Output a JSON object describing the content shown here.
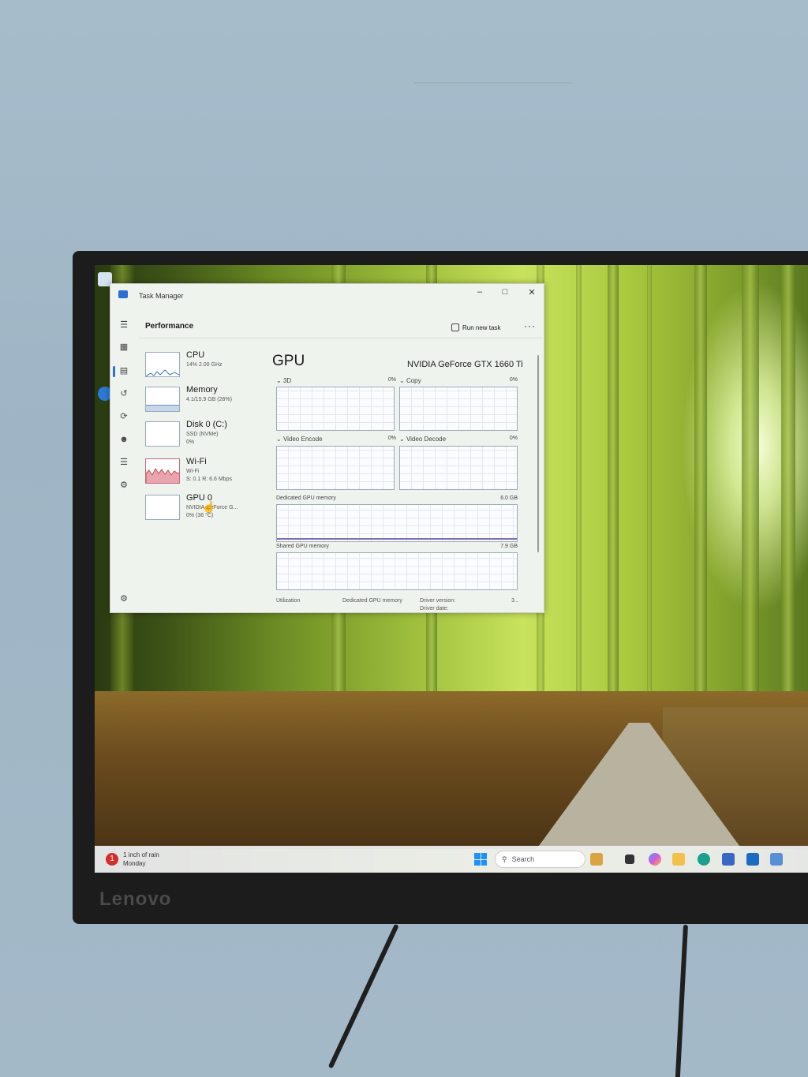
{
  "taskmanager": {
    "title": "Task Manager",
    "section": "Performance",
    "run_new_task": "Run new task",
    "more": "···",
    "items": [
      {
        "name": "CPU",
        "sub1": "14% 2.00 GHz",
        "sub2": "",
        "sub3": ""
      },
      {
        "name": "Memory",
        "sub1": "4.1/15.9 GB (26%)",
        "sub2": "",
        "sub3": ""
      },
      {
        "name": "Disk 0 (C:)",
        "sub1": "SSD (NVMe)",
        "sub2": "0%",
        "sub3": ""
      },
      {
        "name": "Wi-Fi",
        "sub1": "Wi-Fi",
        "sub2": "S: 0.1 R: 6.6 Mbps",
        "sub3": ""
      },
      {
        "name": "GPU 0",
        "sub1": "NVIDIA GeForce G...",
        "sub2": "0% (36 °C)",
        "sub3": ""
      }
    ],
    "gpu": {
      "title": "GPU",
      "model": "NVIDIA GeForce GTX 1660 Ti",
      "graphs": {
        "g3d": {
          "label": "3D",
          "value": "0%"
        },
        "copy": {
          "label": "Copy",
          "value": "0%"
        },
        "video_encode": {
          "label": "Video Encode",
          "value": "0%"
        },
        "video_decode": {
          "label": "Video Decode",
          "value": "0%"
        },
        "dedicated": {
          "label": "Dedicated GPU memory",
          "value": "6.0 GB"
        },
        "shared": {
          "label": "Shared GPU memory",
          "value": "7.9 GB"
        }
      },
      "stats": {
        "utilization": "Utilization",
        "dedicated_memory": "Dedicated GPU memory",
        "driver_version": "Driver version:",
        "driver_version_value": "3...",
        "driver_date": "Driver date:"
      }
    }
  },
  "taskbar": {
    "weather_title": "1 inch of rain",
    "weather_day": "Monday",
    "weather_badge": "1",
    "search_placeholder": "Search"
  },
  "monitor": {
    "brand": "Lenovo"
  },
  "colors": {
    "accent": "#2a6fd6",
    "wifi_graph": "#d7727f",
    "memory_line": "#7f6fb3"
  }
}
